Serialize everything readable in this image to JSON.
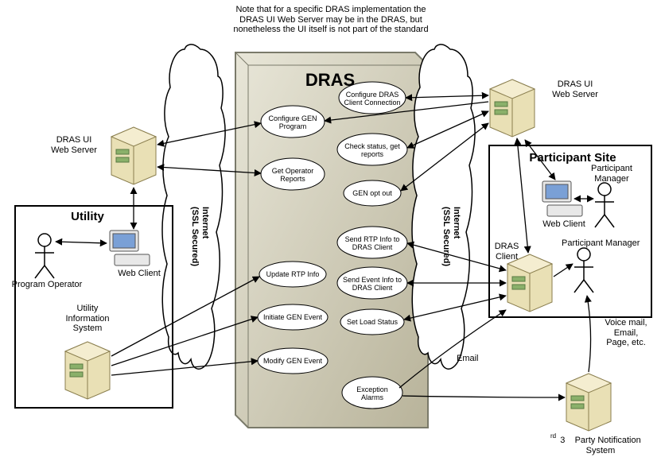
{
  "note": "Note that for a specific DRAS implementation the\nDRAS UI Web Server may be in the DRAS, but\nnonetheless the UI itself is not part of the standard",
  "dras_title": "DRAS",
  "utility_title": "Utility",
  "participant_title": "Participant Site",
  "labels": {
    "dras_ui_left": "DRAS UI\nWeb Server",
    "dras_ui_right": "DRAS UI\nWeb Server",
    "program_operator": "Program Operator",
    "web_client_left": "Web Client",
    "web_client_right": "Web Client",
    "utility_info": "Utility\nInformation\nSystem",
    "internet_left": "Internet\n(SSL Secured)",
    "internet_right": "Internet\n(SSL Secured)",
    "participant_mgr_top": "Participant\nManager",
    "participant_mgr_stick": "Participant Manager",
    "dras_client": "DRAS\nClient",
    "voice_etc": "Voice mail,\nEmail,\nPage, etc.",
    "email": "Email",
    "third_party": "3    Party Notification\nSystem",
    "rd": "rd"
  },
  "ops": {
    "conf_gen": "Configure GEN\nProgram",
    "get_reports": "Get Operator\nReports",
    "conf_dras_cc": "Configure DRAS\nClient Connection",
    "check_status": "Check status, get\nreports",
    "gen_opt": "GEN opt out",
    "send_rtp": "Send RTP Info to\nDRAS Client",
    "send_event": "Send Event Info to\nDRAS Client",
    "set_load": "Set Load Status",
    "upd_rtp": "Update RTP Info",
    "init_gen": "Initiate GEN Event",
    "mod_gen": "Modify GEN Event",
    "exc_alarm": "Exception\nAlarms"
  }
}
